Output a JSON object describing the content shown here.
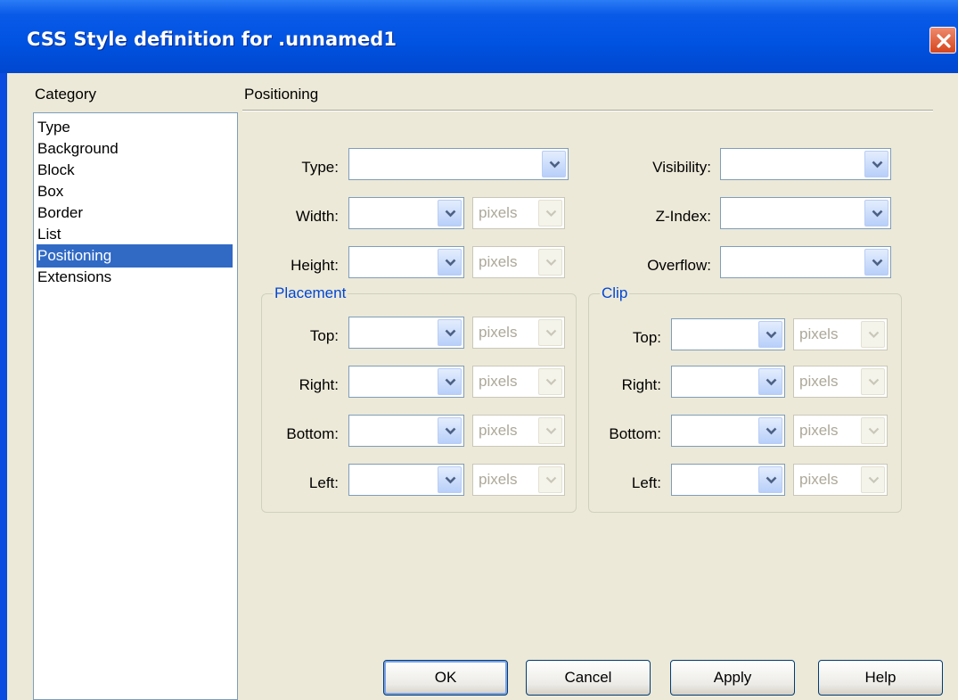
{
  "window": {
    "title": "CSS Style definition for .unnamed1"
  },
  "category": {
    "label": "Category",
    "items": [
      "Type",
      "Background",
      "Block",
      "Box",
      "Border",
      "List",
      "Positioning",
      "Extensions"
    ],
    "selected": "Positioning"
  },
  "panel": {
    "title": "Positioning",
    "type_label": "Type:",
    "type_value": "",
    "width_label": "Width:",
    "width_value": "",
    "width_unit": "pixels",
    "height_label": "Height:",
    "height_value": "",
    "height_unit": "pixels",
    "visibility_label": "Visibility:",
    "visibility_value": "",
    "zindex_label": "Z-Index:",
    "zindex_value": "",
    "overflow_label": "Overflow:",
    "overflow_value": ""
  },
  "placement": {
    "legend": "Placement",
    "top_label": "Top:",
    "right_label": "Right:",
    "bottom_label": "Bottom:",
    "left_label": "Left:",
    "unit": "pixels"
  },
  "clip": {
    "legend": "Clip",
    "top_label": "Top:",
    "right_label": "Right:",
    "bottom_label": "Bottom:",
    "left_label": "Left:",
    "unit": "pixels"
  },
  "buttons": {
    "ok": "OK",
    "cancel": "Cancel",
    "apply": "Apply",
    "help": "Help"
  },
  "colors": {
    "title_bar": "#0052e0",
    "selection": "#316ac5",
    "legend_text": "#0046d5",
    "close_button": "#d6451c"
  },
  "icons": {
    "close": "close-icon",
    "dropdown": "chevron-down-icon"
  }
}
